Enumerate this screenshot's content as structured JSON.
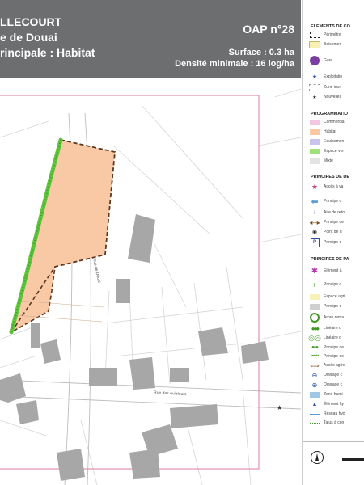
{
  "header": {
    "line1": "LLECOURT",
    "line2": "e de Douai",
    "line3": "rincipale : Habitat",
    "oap": "OAP n°28",
    "surface": "Surface : 0.3 ha",
    "density": "Densité minimale : 16 log/ha"
  },
  "map": {
    "street1": "Rue de Douai",
    "street2": "Rue des Aviateurs"
  },
  "legend": {
    "sections": [
      "ELEMENTS DE CO",
      "PROGRAMMATIO",
      "PRINCIPES DE DE",
      "PRINCIPES DE PA"
    ],
    "items_elements": [
      "Périmètre",
      "Boisemen",
      "Gare",
      "Exploitatio",
      "Zone inon",
      "Nouvelles"
    ],
    "items_prog": [
      "Commercia",
      "Habitat",
      "Equipemen",
      "Espace ver",
      "Mixte"
    ],
    "items_deplacement": [
      "Accès à va",
      "Principe d",
      "Aire de reto",
      "Principe de",
      "Point de d",
      "Principe d"
    ],
    "items_paysage": [
      "Élément à",
      "Principe d",
      "Espace agri",
      "Principe d",
      "Arbre rema",
      "Linéaire d",
      "Linéaire d",
      "Principe de",
      "Accès agric",
      "Ouvrage c",
      "Ouvrage c",
      "Zone humi",
      "Élément hy",
      "Réseau hyd",
      "Talus à con"
    ],
    "colors": {
      "header_bg": "#6d6e70",
      "habitat": "#f9c9a6",
      "commercial": "#f4c6e0",
      "equipement": "#c8c4ef",
      "espace_vert": "#9fe07a",
      "mixte": "#e3e3e3",
      "building": "#a7a7a7",
      "perimeter": "#e07aa6"
    }
  }
}
